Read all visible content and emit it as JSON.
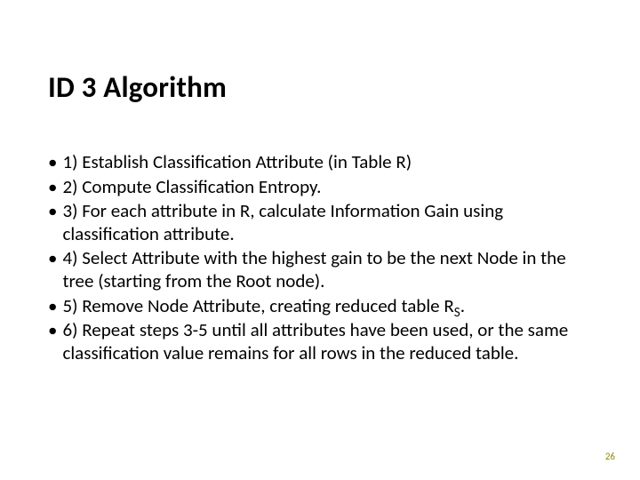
{
  "title": "ID 3 Algorithm",
  "bullets": [
    "1) Establish Classification Attribute (in Table R)",
    "2) Compute Classification Entropy.",
    "3) For each attribute in R, calculate Information Gain using classification attribute.",
    "4) Select Attribute with the highest gain to be the next Node in the tree (starting from the Root node).",
    "5) Remove Node Attribute, creating reduced table R",
    "6) Repeat steps 3-5 until all attributes have been used, or the same classification value remains for all rows in the reduced table."
  ],
  "bullet5_subscript": "S",
  "bullet5_suffix": ".",
  "page_number": "26",
  "bullet_glyph": "•"
}
